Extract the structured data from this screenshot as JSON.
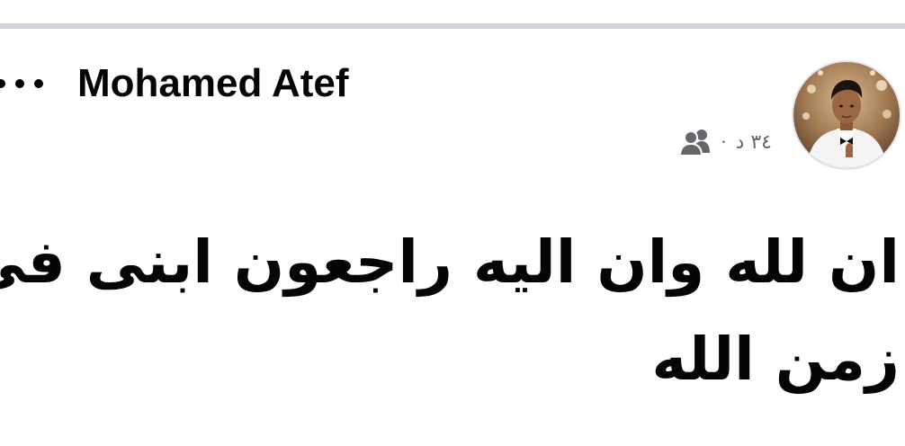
{
  "post": {
    "author": "Mohamed Atef",
    "timestamp": "٣٤ د",
    "separator": "·",
    "audience_icon": "friends-icon",
    "more_icon": "more-options-icon",
    "text_lines": [
      "ان لله وان اليه راجعون ابنى فى",
      "زمن الله"
    ]
  },
  "colors": {
    "divider": "#cfd2d6",
    "primary_text": "#050505",
    "secondary_text": "#65676b",
    "background": "#ffffff"
  }
}
